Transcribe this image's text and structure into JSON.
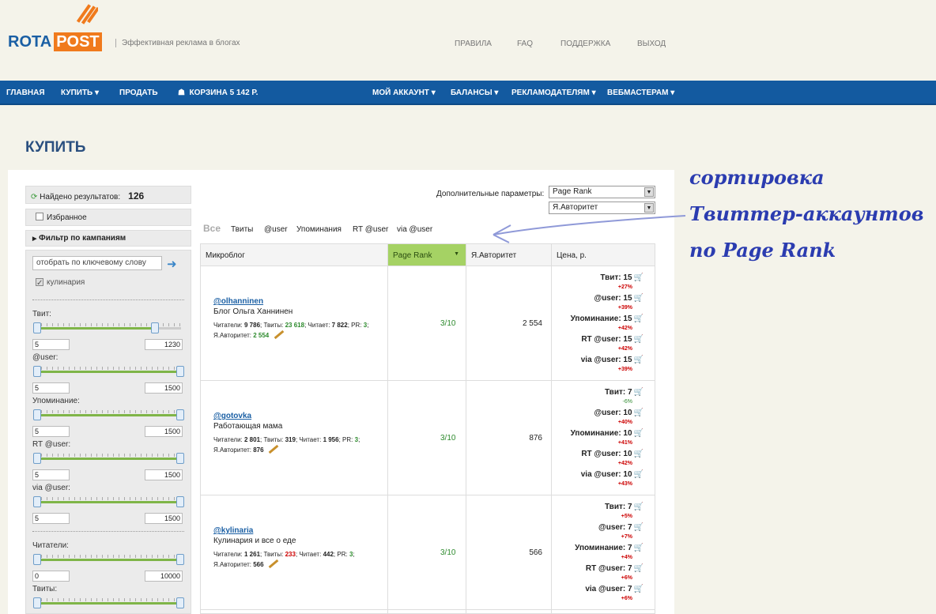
{
  "header": {
    "logo_left": "ROTA",
    "logo_right": "POST",
    "tagline": "Эффективная реклама в блогах",
    "topnav": [
      "ПРАВИЛА",
      "FAQ",
      "ПОДДЕРЖКА",
      "ВЫХОД"
    ]
  },
  "menu": {
    "main": "ГЛАВНАЯ",
    "buy": "КУПИТЬ",
    "sell": "ПРОДАТЬ",
    "cart": "КОРЗИНА 5 142 Р.",
    "account": "МОЙ АККАУНТ",
    "balances": "БАЛАНСЫ",
    "advertisers": "РЕКЛАМОДАТЕЛЯМ",
    "webmasters": "ВЕБМАСТЕРАМ"
  },
  "page": {
    "title": "КУПИТЬ"
  },
  "sidebar": {
    "found_label": "Найдено результатов:",
    "found_count": "126",
    "favorites": "Избранное",
    "campaign_filter": "Фильтр по кампаниям",
    "keyword_placeholder": "отобрать по ключевому слову",
    "keyword_tag": "кулинария",
    "filters": [
      {
        "label": "Твит:",
        "min": "5",
        "max": "1230"
      },
      {
        "label": "@user:",
        "min": "5",
        "max": "1500"
      },
      {
        "label": "Упоминание:",
        "min": "5",
        "max": "1500"
      },
      {
        "label": "RT @user:",
        "min": "5",
        "max": "1500"
      },
      {
        "label": "via @user:",
        "min": "5",
        "max": "1500"
      },
      {
        "label": "Читатели:",
        "min": "0",
        "max": "10000"
      },
      {
        "label": "Твиты:"
      }
    ]
  },
  "params": {
    "label": "Дополнительные параметры:",
    "sort1": "Page Rank",
    "sort2": "Я.Авторитет"
  },
  "tabs": [
    "Все",
    "Твиты",
    "@user",
    "Упоминания",
    "RT @user",
    "via @user"
  ],
  "table": {
    "headers": [
      "Микроблог",
      "Page Rank",
      "Я.Авторитет",
      "Цена, р."
    ],
    "rows": [
      {
        "account": "@olhanninen",
        "name": "Блог Ольга Ханнинен",
        "readers": "9 786",
        "tweets": "23 618",
        "following": "7 822",
        "pr": "3",
        "auth": "2 554",
        "pr_val": "3/10",
        "auth_val": "2 554",
        "prices": [
          {
            "label": "Твит: 15",
            "pct": "+27%"
          },
          {
            "label": "@user: 15",
            "pct": "+39%"
          },
          {
            "label": "Упоминание: 15",
            "pct": "+42%"
          },
          {
            "label": "RT @user: 15",
            "pct": "+42%"
          },
          {
            "label": "via @user: 15",
            "pct": "+39%"
          }
        ]
      },
      {
        "account": "@gotovka",
        "name": "Работающая мама",
        "readers": "2 801",
        "tweets": "319",
        "following": "1 956",
        "pr": "3",
        "auth": "876",
        "pr_val": "3/10",
        "auth_val": "876",
        "prices": [
          {
            "label": "Твит: 7",
            "pct": "-6%"
          },
          {
            "label": "@user: 10",
            "pct": "+40%"
          },
          {
            "label": "Упоминание: 10",
            "pct": "+41%"
          },
          {
            "label": "RT @user: 10",
            "pct": "+42%"
          },
          {
            "label": "via @user: 10",
            "pct": "+43%"
          }
        ]
      },
      {
        "account": "@kylinaria",
        "name": "Кулинария и все о еде",
        "readers": "1 261",
        "tweets": "233",
        "following": "442",
        "pr": "3",
        "auth": "566",
        "pr_val": "3/10",
        "auth_val": "566",
        "prices": [
          {
            "label": "Твит: 7",
            "pct": "+5%"
          },
          {
            "label": "@user: 7",
            "pct": "+7%"
          },
          {
            "label": "Упоминание: 7",
            "pct": "+4%"
          },
          {
            "label": "RT @user: 7",
            "pct": "+6%"
          },
          {
            "label": "via @user: 7",
            "pct": "+6%"
          }
        ]
      }
    ],
    "stat_labels": {
      "readers": "Читатели:",
      "tweets": "Твиты:",
      "following": "Читает:",
      "pr": "PR:",
      "auth": "Я.Авторитет:"
    }
  },
  "annotation": {
    "line1": "сортировка",
    "line2": "Твиттер-аккаунтов",
    "line3": "по Page Rank"
  },
  "colors": {
    "menu": "#135aa0",
    "accent": "#f07a1c",
    "active_header": "#a5d264",
    "annotation": "#2b3cb0"
  }
}
